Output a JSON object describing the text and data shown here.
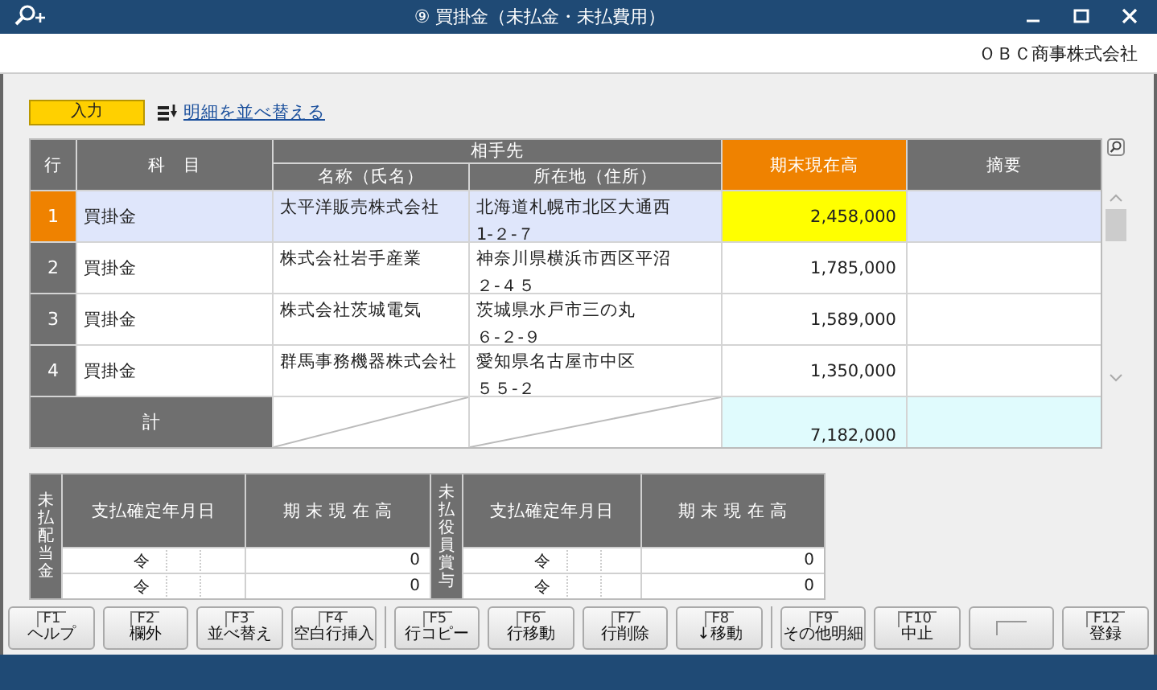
{
  "window": {
    "title": "⑨ 買掛金（未払金・未払費用）"
  },
  "company": "ＯＢＣ商事株式会社",
  "mode_label": "入力",
  "sort_link": "明細を並べ替える",
  "table": {
    "columns": {
      "row": "行",
      "account": "科　目",
      "counterparty": "相手先",
      "name": "名称（氏名）",
      "address": "所在地（住所）",
      "amount": "期末現在高",
      "memo": "摘要"
    },
    "rows": [
      {
        "no": "1",
        "account": "買掛金",
        "name": "太平洋販売株式会社",
        "address": [
          "北海道札幌市北区大通西",
          "1-２-７"
        ],
        "amount": "2,458,000",
        "selected": true
      },
      {
        "no": "2",
        "account": "買掛金",
        "name": "株式会社岩手産業",
        "address": [
          "神奈川県横浜市西区平沼",
          "２-４５"
        ],
        "amount": "1,785,000",
        "selected": false
      },
      {
        "no": "3",
        "account": "買掛金",
        "name": "株式会社茨城電気",
        "address": [
          "茨城県水戸市三の丸",
          "６-２-９"
        ],
        "amount": "1,589,000",
        "selected": false
      },
      {
        "no": "4",
        "account": "買掛金",
        "name": "群馬事務機器株式会社",
        "address": [
          "愛知県名古屋市中区",
          "５５-２"
        ],
        "amount": "1,350,000",
        "selected": false
      }
    ],
    "total_label": "計",
    "total": "7,182,000"
  },
  "sub_tables": [
    {
      "label": "未払配当金",
      "date_header": "支払確定年月日",
      "amount_header": "期 末 現 在 高",
      "rows": [
        {
          "era": "令",
          "amount": "0"
        },
        {
          "era": "令",
          "amount": "0"
        }
      ]
    },
    {
      "label": "未払役員賞与",
      "date_header": "支払確定年月日",
      "amount_header": "期 末 現 在 高",
      "rows": [
        {
          "era": "令",
          "amount": "0"
        },
        {
          "era": "令",
          "amount": "0"
        }
      ]
    }
  ],
  "function_key_groups": [
    [
      {
        "key": "F1",
        "label": "ヘルプ"
      },
      {
        "key": "F2",
        "label": "欄外"
      },
      {
        "key": "F3",
        "label": "並べ替え"
      },
      {
        "key": "F4",
        "label": "空白行挿入"
      }
    ],
    [
      {
        "key": "F5",
        "label": "行コピー"
      },
      {
        "key": "F6",
        "label": "行移動"
      },
      {
        "key": "F7",
        "label": "行削除"
      },
      {
        "key": "F8",
        "label": "↓移動"
      }
    ],
    [
      {
        "key": "F9",
        "label": "その他明細"
      },
      {
        "key": "F10",
        "label": "中止"
      },
      {
        "kind": "blank"
      },
      {
        "key": "F12",
        "label": "登録"
      }
    ]
  ]
}
